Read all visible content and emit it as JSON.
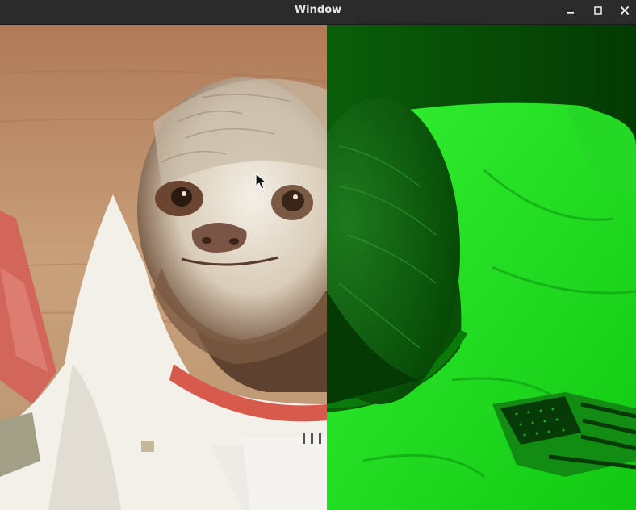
{
  "window": {
    "title": "Window",
    "controls": [
      {
        "name": "minimize",
        "icon": "minimize-icon"
      },
      {
        "name": "maximize",
        "icon": "maximize-icon"
      },
      {
        "name": "close",
        "icon": "close-icon"
      }
    ]
  },
  "content": {
    "image_subject": "sloth-astronaut",
    "left_half_filter": "original",
    "right_half_filter": "green-channel",
    "colors": {
      "background_left": "#b98a67",
      "background_right": "#0b6a0b",
      "suit_left": "#f2efe9",
      "suit_right": "#22e622",
      "fur_light": "#e9e0d2",
      "fur_dark": "#5a3e2c",
      "collar": "#d85a4c"
    },
    "cursor": "arrow-pointer-icon"
  }
}
